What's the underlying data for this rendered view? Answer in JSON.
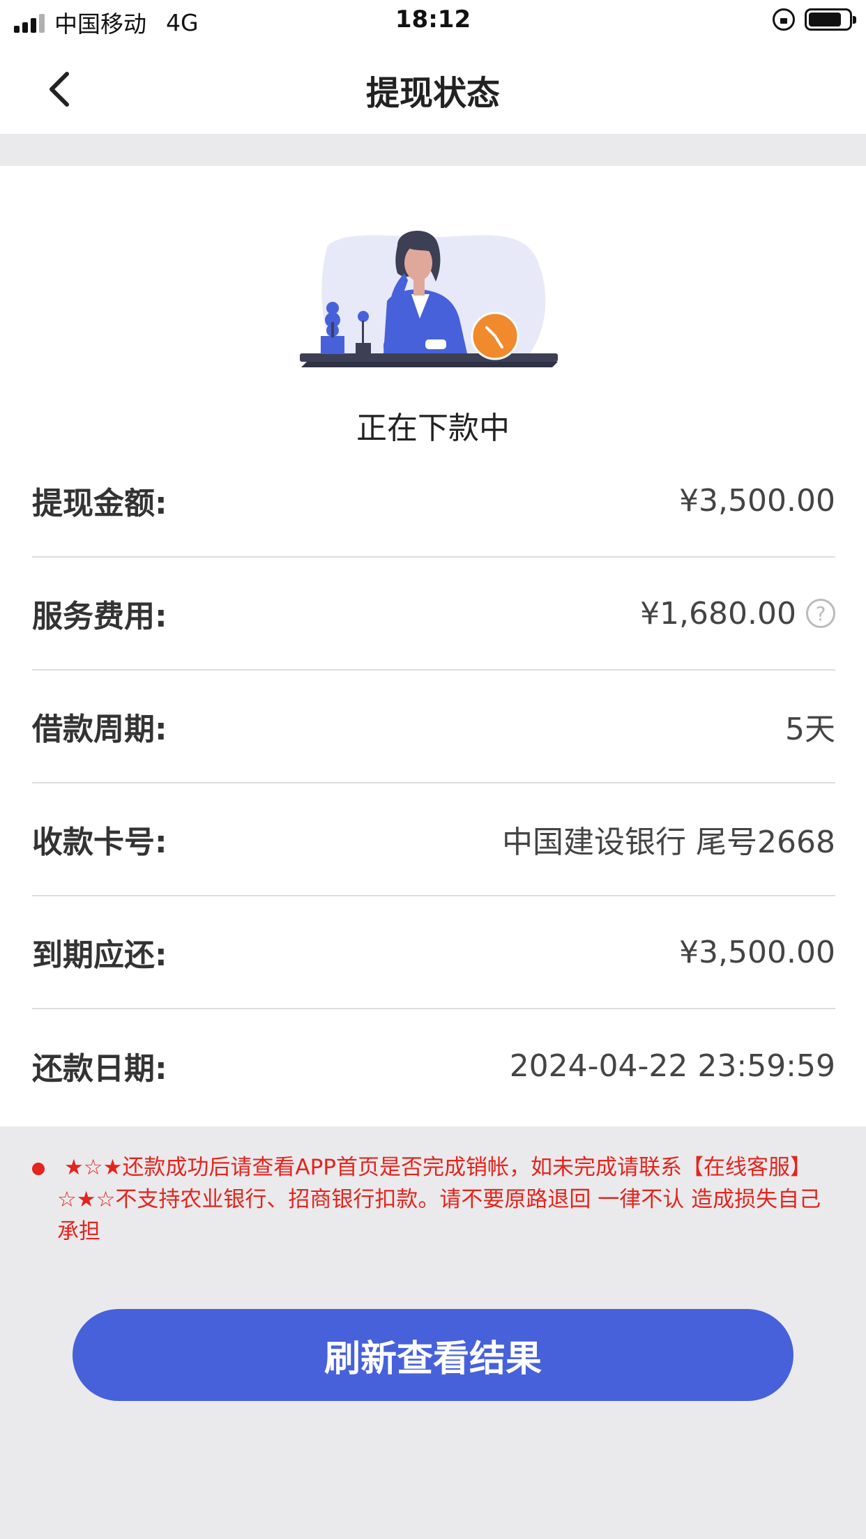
{
  "status_bar": {
    "carrier": "中国移动",
    "network": "4G",
    "time": "18:12"
  },
  "nav": {
    "title": "提现状态",
    "back_icon": "chevron-left-icon"
  },
  "status": {
    "text": "正在下款中",
    "illustration": "woman-waiting-clock-illustration"
  },
  "details": {
    "rows": [
      {
        "label": "提现金额:",
        "value": "¥3,500.00"
      },
      {
        "label": "服务费用:",
        "value": "¥1,680.00",
        "help_icon": "?"
      },
      {
        "label": "借款周期:",
        "value": "5天"
      },
      {
        "label": "收款卡号:",
        "value": "中国建设银行 尾号2668"
      },
      {
        "label": "到期应还:",
        "value": "¥3,500.00"
      },
      {
        "label": "还款日期:",
        "value": "2024-04-22 23:59:59"
      }
    ]
  },
  "notice": {
    "text": "★☆★还款成功后请查看APP首页是否完成销帐，如未完成请联系【在线客服】☆★☆不支持农业银行、招商银行扣款。请不要原路退回 一律不认 造成损失自己承担"
  },
  "actions": {
    "refresh_label": "刷新查看结果"
  },
  "colors": {
    "accent": "#4761db",
    "warning": "#e5241d",
    "background": "#eaeaec"
  }
}
